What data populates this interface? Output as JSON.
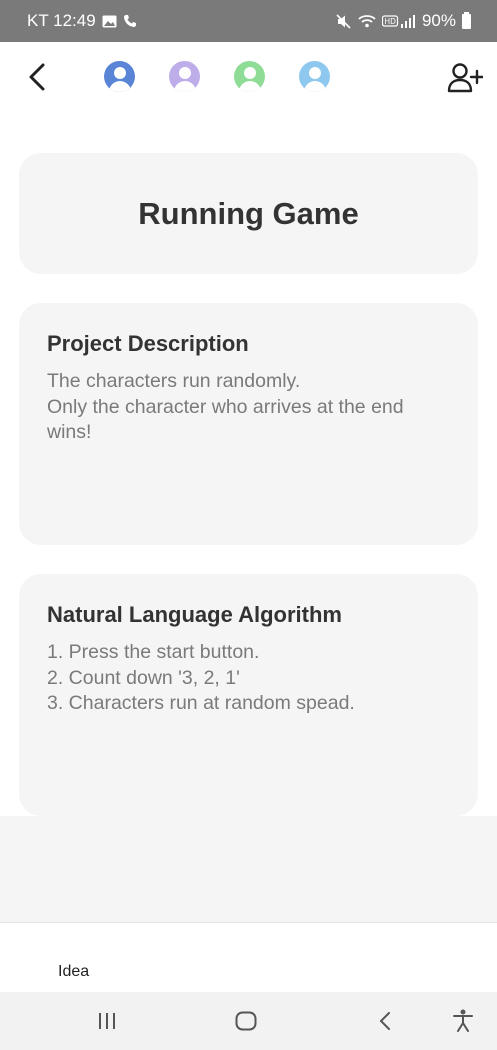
{
  "status_bar": {
    "carrier_time": "KT 12:49",
    "battery": "90%"
  },
  "top_nav": {
    "avatars": [
      {
        "name": "user-1",
        "color": "#5a84d6"
      },
      {
        "name": "user-2",
        "color": "#bdaeea"
      },
      {
        "name": "user-3",
        "color": "#8fdc96"
      },
      {
        "name": "user-4",
        "color": "#8ec8ee"
      }
    ]
  },
  "project": {
    "title": "Running Game",
    "description_heading": "Project Description",
    "description_text": "The characters run randomly.\nOnly the character who arrives at the end wins!",
    "algorithm_heading": "Natural Language Algorithm",
    "algorithm_text": "1. Press the start button.\n2. Count down '3, 2, 1'\n3. Characters run at random spead."
  },
  "bottom": {
    "tab_label": "Idea"
  }
}
